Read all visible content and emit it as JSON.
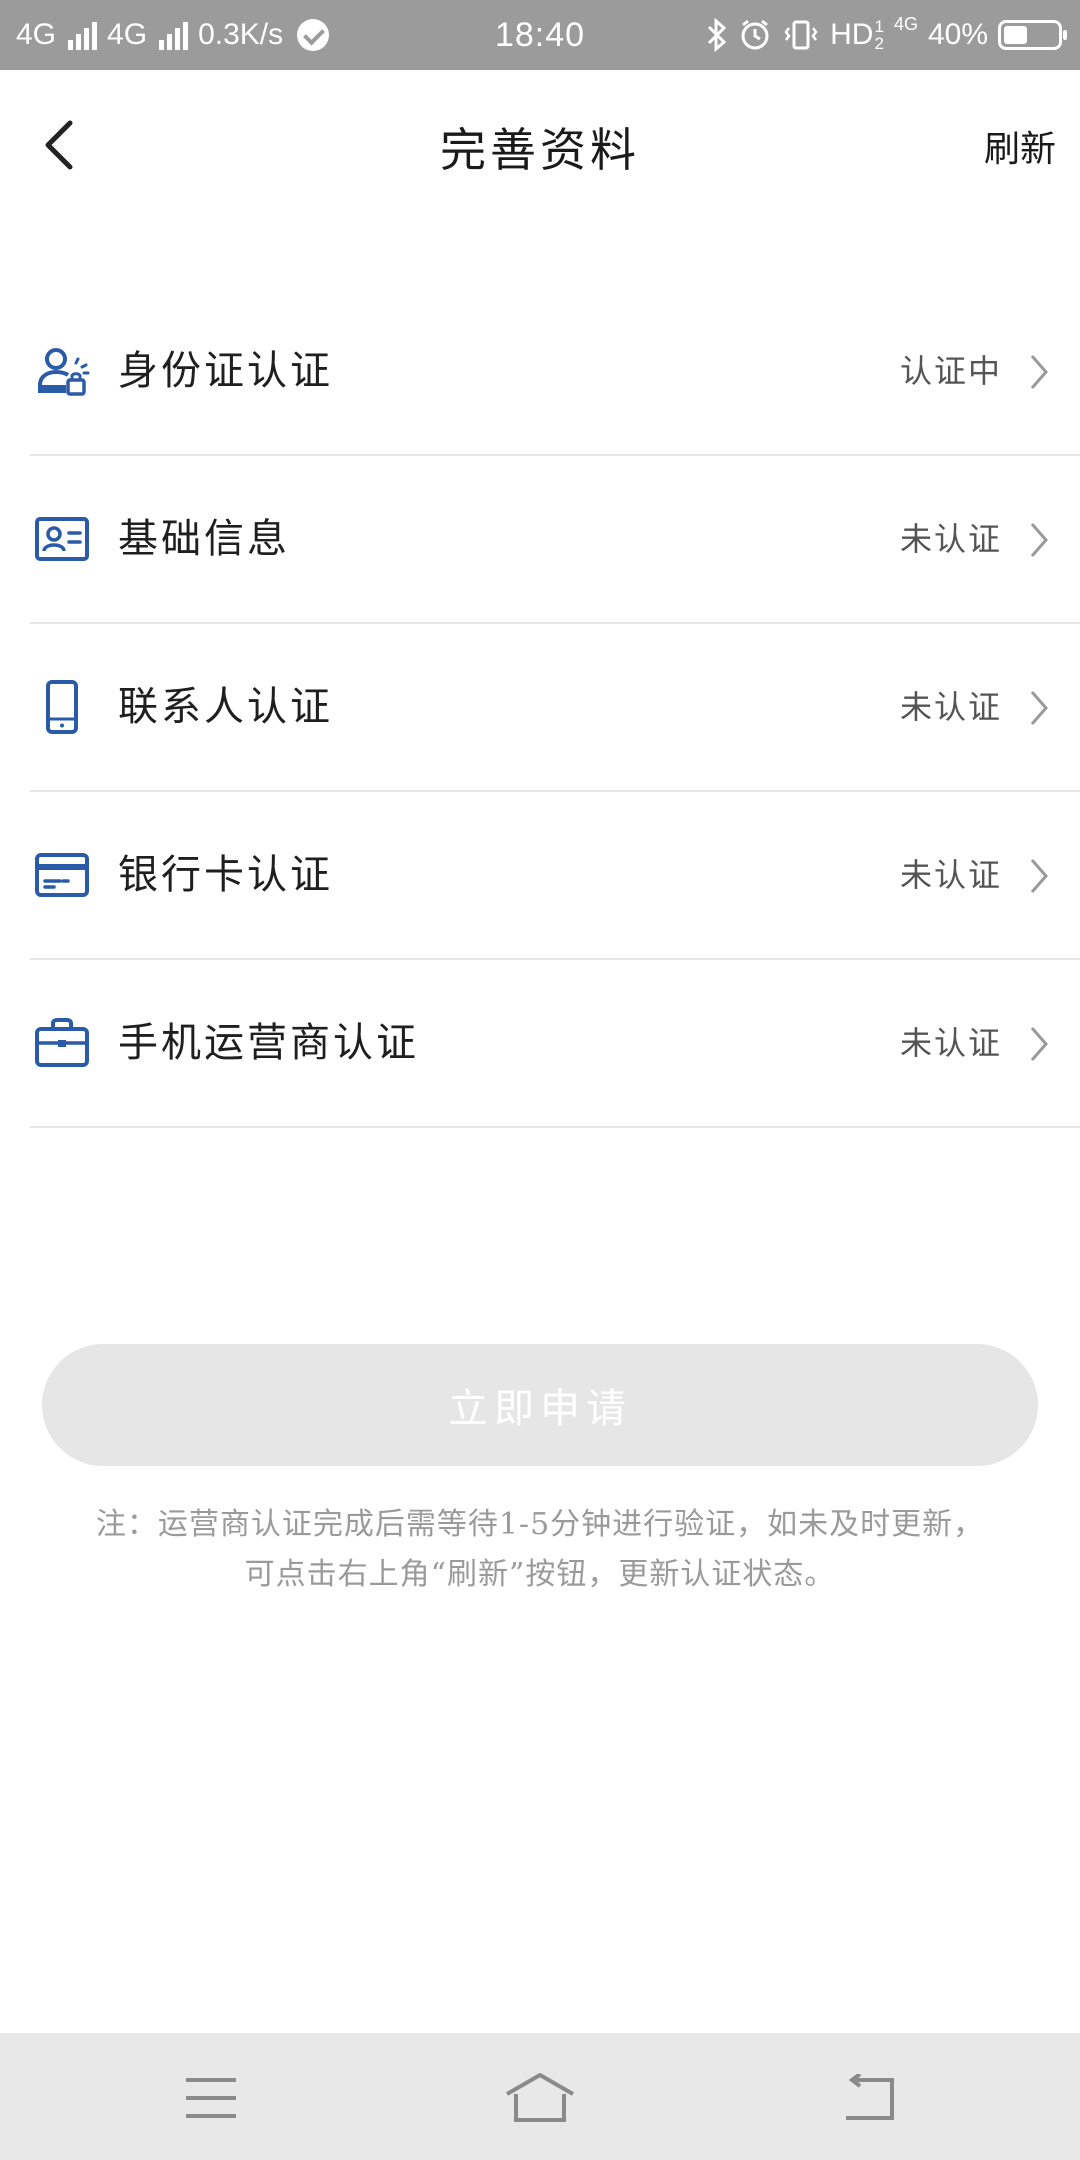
{
  "status_bar": {
    "network1": "4G",
    "network2": "4G",
    "speed": "0.3K/s",
    "time": "18:40",
    "hd_label": "HD",
    "sim_top": "1",
    "sim_bottom": "2",
    "net_small": "4G",
    "battery": "40%"
  },
  "header": {
    "title": "完善资料",
    "refresh_label": "刷新"
  },
  "items": [
    {
      "label": "身份证认证",
      "status": "认证中",
      "icon": "id-verify-icon"
    },
    {
      "label": "基础信息",
      "status": "未认证",
      "icon": "id-card-icon"
    },
    {
      "label": "联系人认证",
      "status": "未认证",
      "icon": "phone-icon"
    },
    {
      "label": "银行卡认证",
      "status": "未认证",
      "icon": "bank-card-icon"
    },
    {
      "label": "手机运营商认证",
      "status": "未认证",
      "icon": "briefcase-icon"
    }
  ],
  "apply_button": "立即申请",
  "note_line1": "注：运营商认证完成后需等待1-5分钟进行验证，如未及时更新，",
  "note_line2": "可点击右上角“刷新”按钮，更新认证状态。",
  "colors": {
    "accent": "#2a5ba8",
    "status_bar": "#9b9b9b",
    "button_disabled": "#e6e6e6"
  }
}
